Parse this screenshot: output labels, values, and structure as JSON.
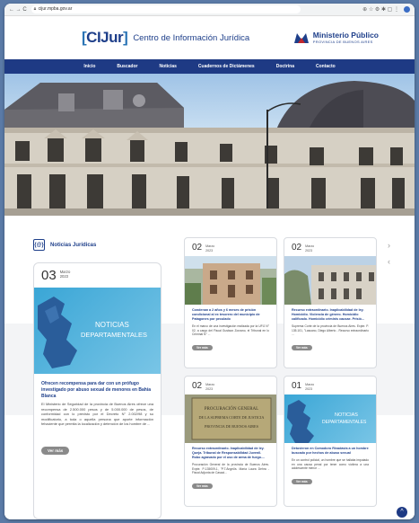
{
  "browser": {
    "nav_glyphs": "← → C",
    "url": "cijur.mpba.gov.ar",
    "toolbar_glyphs": "⊕ ☆ ⚙ ✱ ▢ ⋮"
  },
  "header": {
    "logo_bracket_open": "[",
    "logo_mark": "CIJur",
    "logo_bracket_close": "]",
    "site_name": "Centro de Información Jurídica",
    "ministry_line1": "Ministerio Público",
    "ministry_line2": "PROVINCIA DE BUENOS AIRES"
  },
  "nav": {
    "items": [
      "Inicio",
      "Buscador",
      "Noticias",
      "Cuadernos de Dictámenes",
      "Doctrina",
      "Contacto"
    ]
  },
  "news": {
    "section_icon": "{@}",
    "section_title": "Noticias Jurídicas",
    "arrows": {
      "next": "›",
      "prev": "‹"
    },
    "featured": {
      "day": "03",
      "month": "Marzo",
      "year": "2023",
      "image_text_line1": "NOTICIAS",
      "image_text_line2": "DEPARTAMENTALES",
      "title": "Ofrecen recompensa para dar con un prófugo investigado por abuso sexual de menores en Bahía Blanca",
      "text": "El Ministerio de Seguridad de la provincia de Buenos Aires ofrece una recompensa de 2.500.000 pesos y de 5.000.000 de pesos, de conformidad con lo previsto por el Decreto N° 2.002/98 y su modificatorio, a toda o aquella persona que aporte información fehaciente que permita la localización y detención de los hombre de ...",
      "button": "Ver más"
    },
    "cards": [
      {
        "day": "02",
        "month": "Marzo",
        "year": "2023",
        "title": "Condenan a 2 años y 6 meses de prisión condicional al ex tesorero del municipio de Patagones por peculado",
        "text": "En el marco de una investigación realizada por la UFIJ N° 02, a cargo del Fiscal Gustavo Zorzano, el Tribunal en lo Criminal N° ...",
        "button": "Ver más"
      },
      {
        "day": "02",
        "month": "Marzo",
        "year": "2023",
        "title": "Recurso extraordinario. Inaplicabilidad de ley. Homicidio. Violencia de género. Homicidio calificado. Homicidio criminis causae. Prisió...",
        "text": "Suprema Corte de la provincia de Buenos Aires. Expte. P. 135.101, \"Lascano, Diego Alberto - Recurso extraordinario ...",
        "button": "Ver más"
      },
      {
        "day": "02",
        "month": "Marzo",
        "year": "2023",
        "plaque_line1": "PROCURACIÓN GENERAL",
        "plaque_line2": "DE LA SUPREMA CORTE DE JUSTICIA",
        "plaque_line3": "PROVINCIA DE BUENOS AIRES",
        "title": "Recurso extraordinario. Inaplicabilidad de ley. Queja. Tribunal de Responsabilidad Juvenil. Robo agravado por el uso de arma de fuego....",
        "text": "Procuración General de la provincia de Buenos Aires. Expte. P-135009-1, \"P.T.Ángel/a. María Laura Dehra - Fiscal Adjunta de Casaci...",
        "button": "Ver más"
      },
      {
        "day": "01",
        "month": "Marzo",
        "year": "2023",
        "image_text_line1": "NOTICIAS",
        "image_text_line2": "DEPARTAMENTALES",
        "title": "Detuvieron en Comodoro Rivadavia a un hombre buscado por hechos de abuso sexual",
        "text": "En un control policial, un hombre que se hallaba imputado en una causa penal por tener como víctima a una adolescente menor ...",
        "button": "Ver más"
      }
    ]
  },
  "scroll_top": "^",
  "colors": {
    "brand_blue": "#1e3a84",
    "link_blue": "#1e3f8a",
    "button_gray": "#8a8a8a"
  }
}
